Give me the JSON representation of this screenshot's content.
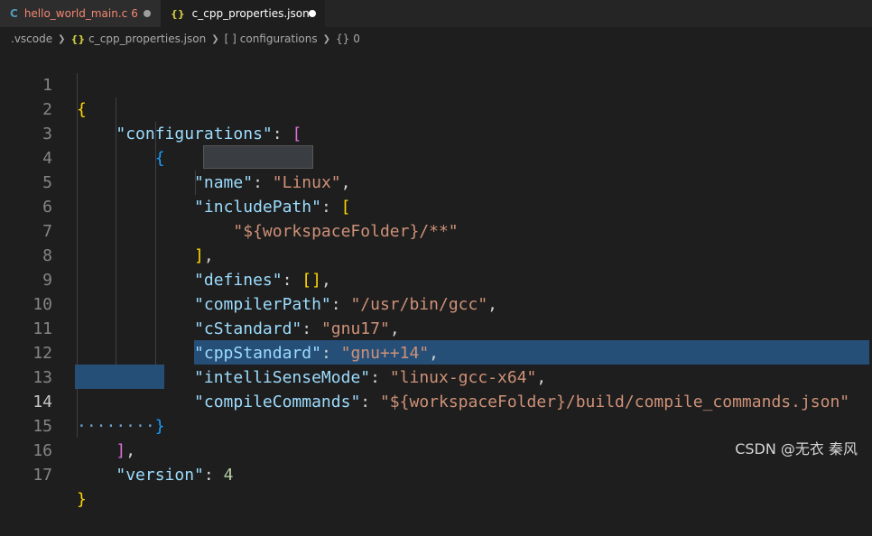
{
  "tabs": [
    {
      "icon": "c-language-icon",
      "icon_text": "C",
      "label": "hello_world_main.c",
      "badge": "6"
    },
    {
      "icon": "json-braces-icon",
      "icon_text": "{}",
      "label": "c_cpp_properties.json"
    }
  ],
  "breadcrumb": {
    "folder": ".vscode",
    "file_icon": "{}",
    "file": "c_cpp_properties.json",
    "array_icon": "[ ]",
    "array": "configurations",
    "object_icon": "{}",
    "index": "0"
  },
  "editor": {
    "line_numbers": [
      "1",
      "2",
      "3",
      "4",
      "5",
      "6",
      "7",
      "8",
      "9",
      "10",
      "11",
      "12",
      "13",
      "14",
      "15",
      "16",
      "17"
    ],
    "active_line": "14",
    "code": {
      "l1_open": "{",
      "configurations_key": "\"configurations\"",
      "array_open": "[",
      "object_open": "{",
      "name_key": "\"name\"",
      "name_val": "\"Linux\"",
      "include_q1": "\"",
      "include_word": "includePath",
      "include_q2": "\"",
      "include_open": "[",
      "include_val": "\"${workspaceFolder}/**\"",
      "include_close": "]",
      "defines_key": "\"defines\"",
      "defines_val": "[]",
      "compiler_key": "\"compilerPath\"",
      "compiler_val": "\"/usr/bin/gcc\"",
      "cstd_key": "\"cStandard\"",
      "cstd_val": "\"gnu17\"",
      "cppstd_key": "\"cppStandard\"",
      "cppstd_val": "\"gnu++14\"",
      "intelli_key": "\"intelliSenseMode\"",
      "intelli_val": "\"linux-gcc-x64\"",
      "compile_key": "\"compileCommands\"",
      "compile_val": "\"${workspaceFolder}/build/compile_commands.json\"",
      "whitespace_dots": "········",
      "object_close": "}",
      "array_close": "]",
      "version_key": "\"version\"",
      "version_val": "4",
      "l17_close": "}"
    }
  },
  "watermark": "CSDN @无衣 秦风",
  "colors": {
    "background": "#1e1e1e",
    "key": "#9cdcfe",
    "string": "#ce9178",
    "number": "#b5cea8",
    "bracket_gold": "#ffd700",
    "bracket_purple": "#da70d6",
    "bracket_blue": "#179fff",
    "selection": "#264f78",
    "tab_modified": "#f48771"
  }
}
